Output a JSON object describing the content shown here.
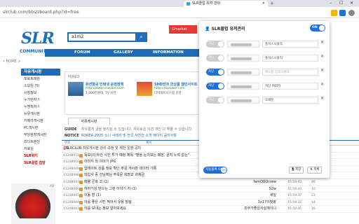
{
  "browser": {
    "tab_title": "SLR클럽 유저 관리",
    "url": "slrclub.com/bbs/zboard.php?id=free"
  },
  "site": {
    "logo": "SLR",
    "search_value": "a1m2",
    "gmarket": "Gmarket",
    "community_label": "COMMUNITY",
    "nav": [
      "FORUM",
      "GALLERY",
      "INFORMATION"
    ],
    "breadcrumb": "• HOME >",
    "sidebar": {
      "header": "자유게시판",
      "items": [
        "포토트레킹",
        "소모임 (5)",
        "시장정보",
        "누가먼저ㅋ",
        "누명뭐저ㅋ",
        "뉴뮤게시판",
        "카메라게시판",
        "PC게시판",
        "부당한장게시판",
        "리더트렌딩",
        "자료실",
        "SLR위키",
        "SLR클럽 잡담"
      ],
      "hot_label": "잡담",
      "ad_tag": "AD"
    },
    "ad_box": {
      "header": "파워링크",
      "units": [
        {
          "title": "뮤션항공 인테넷 운영정책",
          "url": "http://www.nnwebn.com",
          "desc": "1,000만원대, TV 사전"
        },
        {
          "title": "SHD방과 한상품 웹인사이트",
          "url": "http://dcpower.com",
          "desc": "다이렉트시스템 운영"
        }
      ]
    },
    "board_tab": "자유게시판",
    "guide": {
      "guide_label": "GUIDE",
      "guide_text": "자유롭게 글을 올리실 수 있습니다. 자유로운 의견 개진 다 해줄 수 있습니다.",
      "notice_label": "NOTICE",
      "notice_text": "KOREA 2025 소니 사례리 및 전국 사진전 소개 페이지 공지사항"
    },
    "table": {
      "header_num": "번호",
      "header_subject": "제목",
      "rows": [
        {
          "num": "공지",
          "subject": "SLRCLUB 자유게시판 관리 규정 및 제한 운영 공지",
          "author": "",
          "date": "",
          "hits": "",
          "rec": "",
          "notice": true
        },
        {
          "num": "41248051",
          "subject": "독보(이)두칸 사진 투가 예정 제목 \"팬을 눈치보는 패장, 궁지 노력 없는\"",
          "author": "",
          "date": "15:59:57",
          "hits": "0",
          "rec": "",
          "notice": false
        },
        {
          "num": "41248050",
          "subject": "이미지 외 이야기 JPG",
          "author": "",
          "date": "15:59:57",
          "hits": "0",
          "rec": "",
          "notice": false
        },
        {
          "num": "41248049",
          "subject": "업데이트 상품 정보 확인 주문 게시판 데이터 기록",
          "author": "",
          "date": "15:59:52",
          "hits": "7",
          "rec": "",
          "notice": false
        },
        {
          "num": "41248048",
          "subject": "와입사 중 건님께님 주목문 외장교 과제금",
          "author": "[The]해린문처",
          "date": "15:59:47",
          "hits": "4",
          "rec": "",
          "notice": false
        },
        {
          "num": "41248047",
          "subject": "매물 군포 코 (1)",
          "author": "famO0Ocrew",
          "date": "15:59:43",
          "hits": "46",
          "rec": "",
          "notice": false
        },
        {
          "num": "41248046",
          "subject": "이야기성 만드는 그런 이야기 지 (1)",
          "author": "S2w",
          "date": "15:59:40",
          "hits": "10",
          "rec": "",
          "notice": false
        },
        {
          "num": "41248045",
          "subject": "이동 장 (1)",
          "author": "세잎",
          "date": "15:59:37",
          "hits": "23",
          "rec": "",
          "notice": false
        },
        {
          "num": "41248044",
          "subject": "이를 좋은 사진 찍어서 유용 말씀",
          "author": "1x17이빛랑",
          "date": "15:59:32",
          "hits": "14",
          "rec": "",
          "notice": false
        },
        {
          "num": "41248043",
          "subject": "이를 보내는 정보 알아보세요",
          "author": "조무가좋은사실계이니",
          "date": "15:59:31",
          "hits": "16",
          "rec": "",
          "notice": false
        }
      ]
    }
  },
  "panel": {
    "title": "SLR클럽 유저관리",
    "main_toggle": "ON",
    "rows": [
      {
        "state": "차단",
        "active": false,
        "memo": "홍석스시블직",
        "placeholder": false
      },
      {
        "state": "차단",
        "active": false,
        "memo": "홍석스시블직",
        "placeholder": false
      },
      {
        "state": "차단",
        "active": true,
        "memo": "메모를 입력하세요",
        "placeholder": true
      },
      {
        "state": "차단",
        "active": true,
        "memo": "차단 여러자",
        "placeholder": false
      },
      {
        "state": "차단",
        "active": false,
        "memo": "도배문",
        "placeholder": false
      }
    ],
    "autosave_label": "자동블록 ON",
    "autosave_knob": "ON",
    "btn_save": "저장",
    "btn_export": "목록"
  },
  "colors": {
    "accent": "#1e6fd9",
    "site_blue": "#1d6bb5"
  }
}
